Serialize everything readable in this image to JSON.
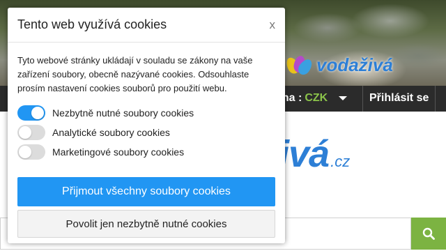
{
  "site": {
    "hero_logo_text": "vodaživá",
    "currency_label": "ěna :",
    "currency_value": "CZK",
    "login_label": "Přihlásit se",
    "logo_main": "ivá",
    "logo_tld": ".cz",
    "search_placeholder": ""
  },
  "cookie_dialog": {
    "title": "Tento web využívá cookies",
    "close_label": "x",
    "description": "Tyto webové stránky ukládají v souladu se zákony na vaše zařízení soubory, obecně nazývané cookies. Odsouhlaste prosím nastavení cookies souborů pro použití webu.",
    "toggles": [
      {
        "label": "Nezbytně nutné soubory cookies",
        "enabled": true
      },
      {
        "label": "Analytické soubory cookies",
        "enabled": false
      },
      {
        "label": "Marketingové soubory cookies",
        "enabled": false
      }
    ],
    "accept_all_label": "Přijmout všechny soubory cookies",
    "necessary_only_label": "Povolit jen nezbytně nutné cookies"
  },
  "colors": {
    "accent_blue": "#2196f3",
    "nav_bg": "#2b2b2b",
    "currency_green": "#8bc34a",
    "search_green": "#7cb342"
  },
  "icons": {
    "search": "search-icon",
    "caret": "chevron-down-icon"
  }
}
